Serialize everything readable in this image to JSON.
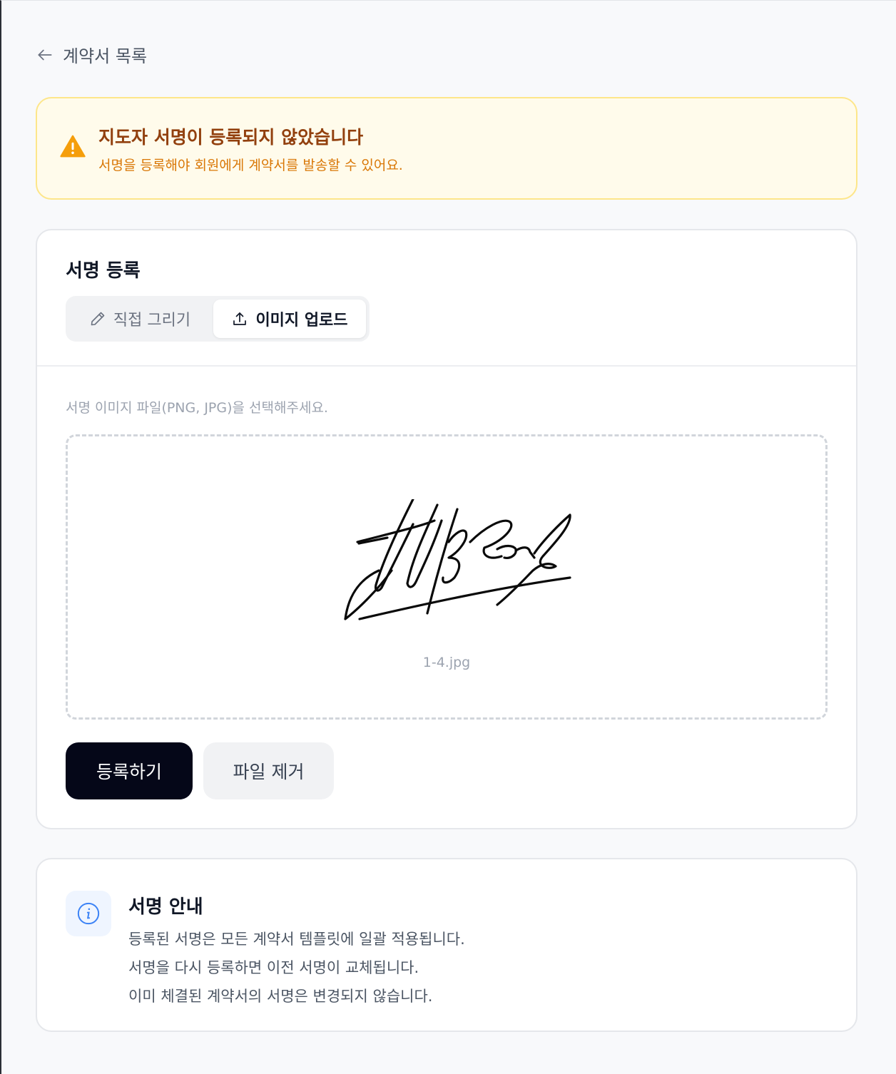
{
  "nav": {
    "back_label": "계약서 목록",
    "back_icon": "arrow-left-icon"
  },
  "alert": {
    "icon": "warning-triangle-icon",
    "title": "지도자 서명이 등록되지 않았습니다",
    "description": "서명을 등록해야 회원에게 계약서를 발송할 수 있어요."
  },
  "register_card": {
    "title": "서명 등록",
    "tabs": [
      {
        "label": "직접 그리기",
        "icon": "pencil-icon",
        "active": false
      },
      {
        "label": "이미지 업로드",
        "icon": "upload-icon",
        "active": true
      }
    ],
    "hint": "서명 이미지 파일(PNG, JPG)을 선택해주세요.",
    "file_name": "1-4.jpg",
    "register_button": "등록하기",
    "remove_button": "파일 제거"
  },
  "info_card": {
    "icon": "info-icon",
    "title": "서명 안내",
    "lines": [
      "등록된 서명은 모든 계약서 템플릿에 일괄 적용됩니다.",
      "서명을 다시 등록하면 이전 서명이 교체됩니다.",
      "이미 체결된 계약서의 서명은 변경되지 않습니다."
    ]
  },
  "colors": {
    "primary_button": "#050718",
    "alert_background": "#fffbeb",
    "alert_border": "#fde68a",
    "alert_title": "#92400e",
    "alert_text": "#d97706",
    "info_accent": "#3b82f6"
  }
}
